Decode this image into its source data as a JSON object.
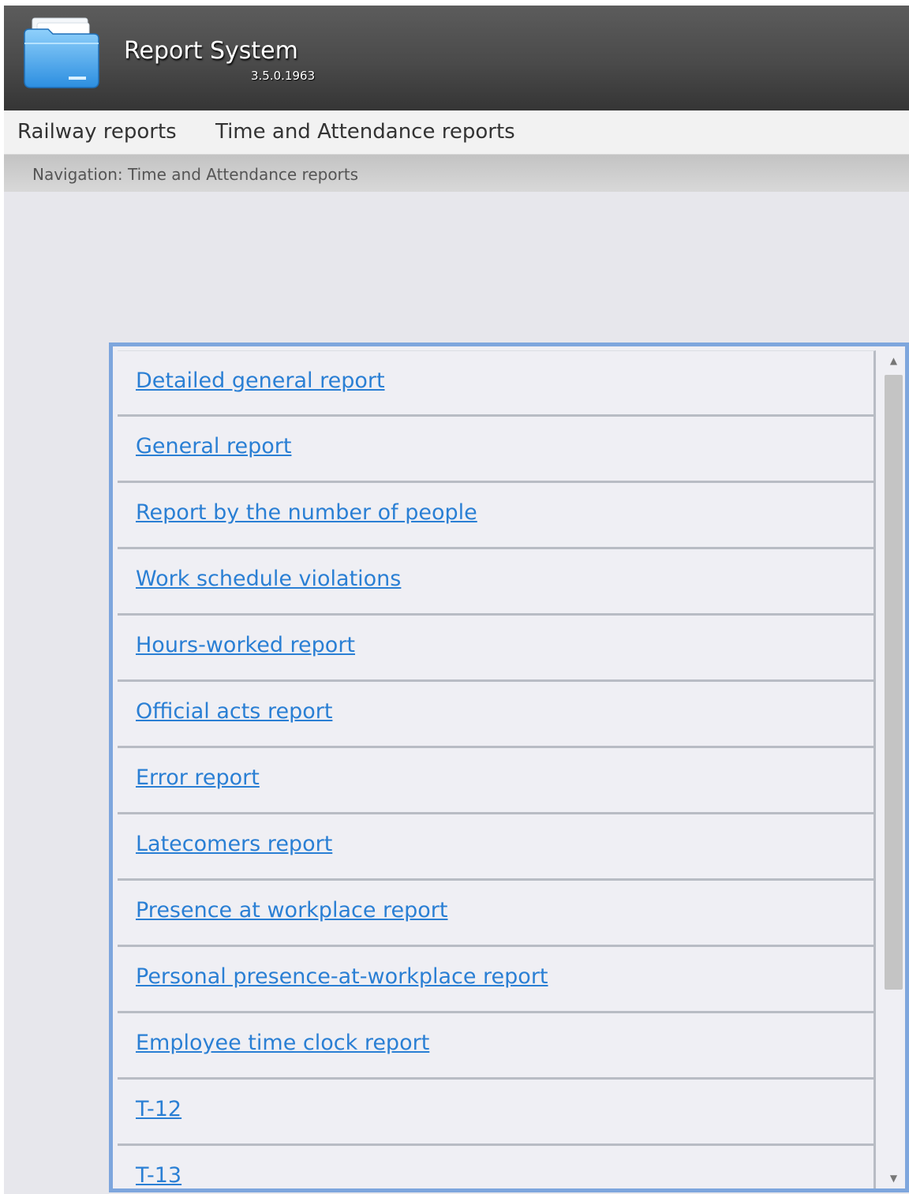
{
  "header": {
    "title": "Report System",
    "version": "3.5.0.1963",
    "logo_icon": "folder-icon"
  },
  "menu": {
    "items": [
      {
        "label": "Railway reports"
      },
      {
        "label": "Time and Attendance reports"
      }
    ]
  },
  "navigation": {
    "text": "Navigation: Time and Attendance reports"
  },
  "reports": {
    "items": [
      {
        "label": "Detailed general report"
      },
      {
        "label": "General report"
      },
      {
        "label": "Report by the number of people"
      },
      {
        "label": "Work schedule violations"
      },
      {
        "label": "Hours-worked report"
      },
      {
        "label": "Official acts report"
      },
      {
        "label": "Error report"
      },
      {
        "label": "Latecomers report"
      },
      {
        "label": "Presence at workplace report"
      },
      {
        "label": "Personal presence-at-workplace report"
      },
      {
        "label": "Employee time clock report"
      },
      {
        "label": "T-12"
      },
      {
        "label": "T-13"
      }
    ]
  },
  "colors": {
    "header_bg": "#4a4a4a",
    "link": "#2a7fd4",
    "panel_border": "#7ea6dd"
  }
}
